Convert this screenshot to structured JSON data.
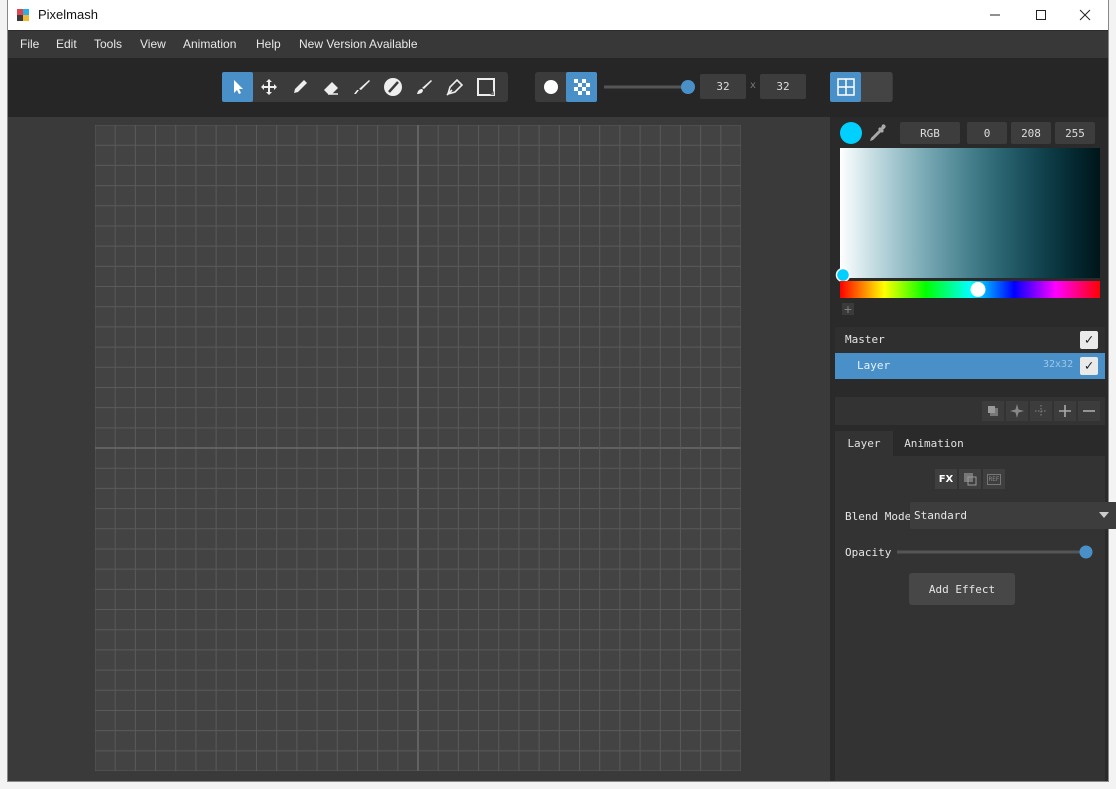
{
  "window": {
    "title": "Pixelmash"
  },
  "window_controls": {
    "minimize": "—",
    "maximize": "☐",
    "close": "✕"
  },
  "menu": [
    "File",
    "Edit",
    "Tools",
    "View",
    "Animation",
    "Help",
    "New Version Available"
  ],
  "toolbar": {
    "tools": [
      {
        "name": "select-tool",
        "icon": "pointer-icon",
        "active": true
      },
      {
        "name": "move-tool",
        "icon": "move-arrows-icon",
        "active": false
      },
      {
        "name": "pencil-tool",
        "icon": "pencil-icon",
        "active": false
      },
      {
        "name": "eraser-tool",
        "icon": "eraser-icon",
        "active": false
      },
      {
        "name": "brush-tool",
        "icon": "brush-icon",
        "active": false
      },
      {
        "name": "no-paint-tool",
        "icon": "slash-circle-icon",
        "active": false
      },
      {
        "name": "paint-brush-tool",
        "icon": "paintbrush-icon",
        "active": false
      },
      {
        "name": "pen-tool",
        "icon": "pen-icon",
        "active": false
      },
      {
        "name": "rectangle-tool",
        "icon": "square-icon",
        "active": false
      }
    ],
    "brush_shapes": [
      {
        "name": "round-brush",
        "icon": "circle-icon",
        "active": false
      },
      {
        "name": "dither-brush",
        "icon": "checker-icon",
        "active": true
      }
    ],
    "brush_size_fraction": 1.0,
    "width": "32",
    "separator": "x",
    "height": "32",
    "view_modes": [
      {
        "name": "grid-view",
        "icon": "grid-icon",
        "active": true
      },
      {
        "name": "single-view",
        "icon": "blank-icon",
        "active": false
      }
    ]
  },
  "canvas": {
    "cells": 32,
    "grid_on": true
  },
  "color": {
    "current_hex": "#00d0ff",
    "mode": "RGB",
    "r": "0",
    "g": "208",
    "b": "255",
    "hue_fraction": 0.53,
    "add_swatch": "+"
  },
  "layers": {
    "master_label": "Master",
    "master_visible": true,
    "items": [
      {
        "name": "Layer",
        "size": "32x32",
        "visible": true,
        "selected": true
      }
    ]
  },
  "tabs": [
    {
      "label": "Layer",
      "active": true
    },
    {
      "label": "Animation",
      "active": false
    }
  ],
  "layer_props": {
    "fx_labels": [
      "FX",
      "REF"
    ],
    "blend_mode_label": "Blend Mode",
    "blend_mode_value": "Standard",
    "opacity_label": "Opacity",
    "opacity_fraction": 1.0,
    "add_effect_label": "Add Effect"
  },
  "accent": "#4a90c8"
}
